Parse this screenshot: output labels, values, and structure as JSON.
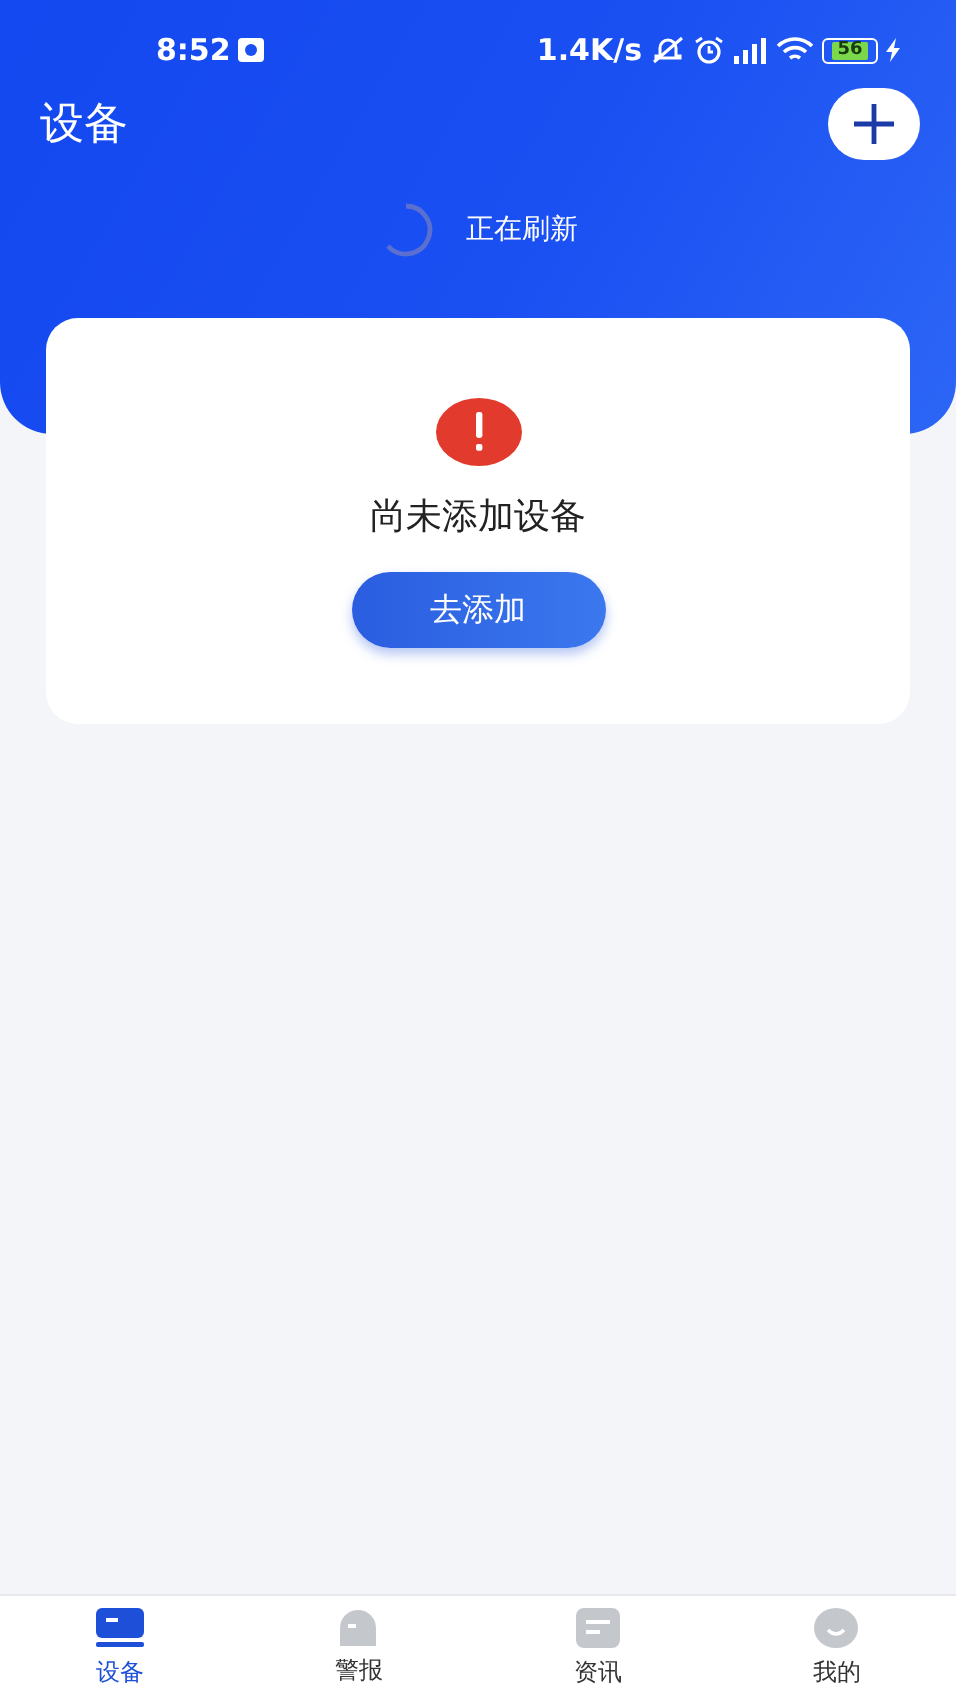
{
  "status_bar": {
    "time": "8:52",
    "speed": "1.4K/s",
    "battery": "56"
  },
  "header": {
    "title": "设备",
    "refresh_text": "正在刷新"
  },
  "empty_card": {
    "message": "尚未添加设备",
    "button": "去添加"
  },
  "tab_bar": [
    {
      "label": "设备",
      "kind": "device",
      "selected": true
    },
    {
      "label": "警报",
      "kind": "alarm",
      "selected": false
    },
    {
      "label": "资讯",
      "kind": "news",
      "selected": false
    },
    {
      "label": "我的",
      "kind": "profile",
      "selected": false
    }
  ]
}
